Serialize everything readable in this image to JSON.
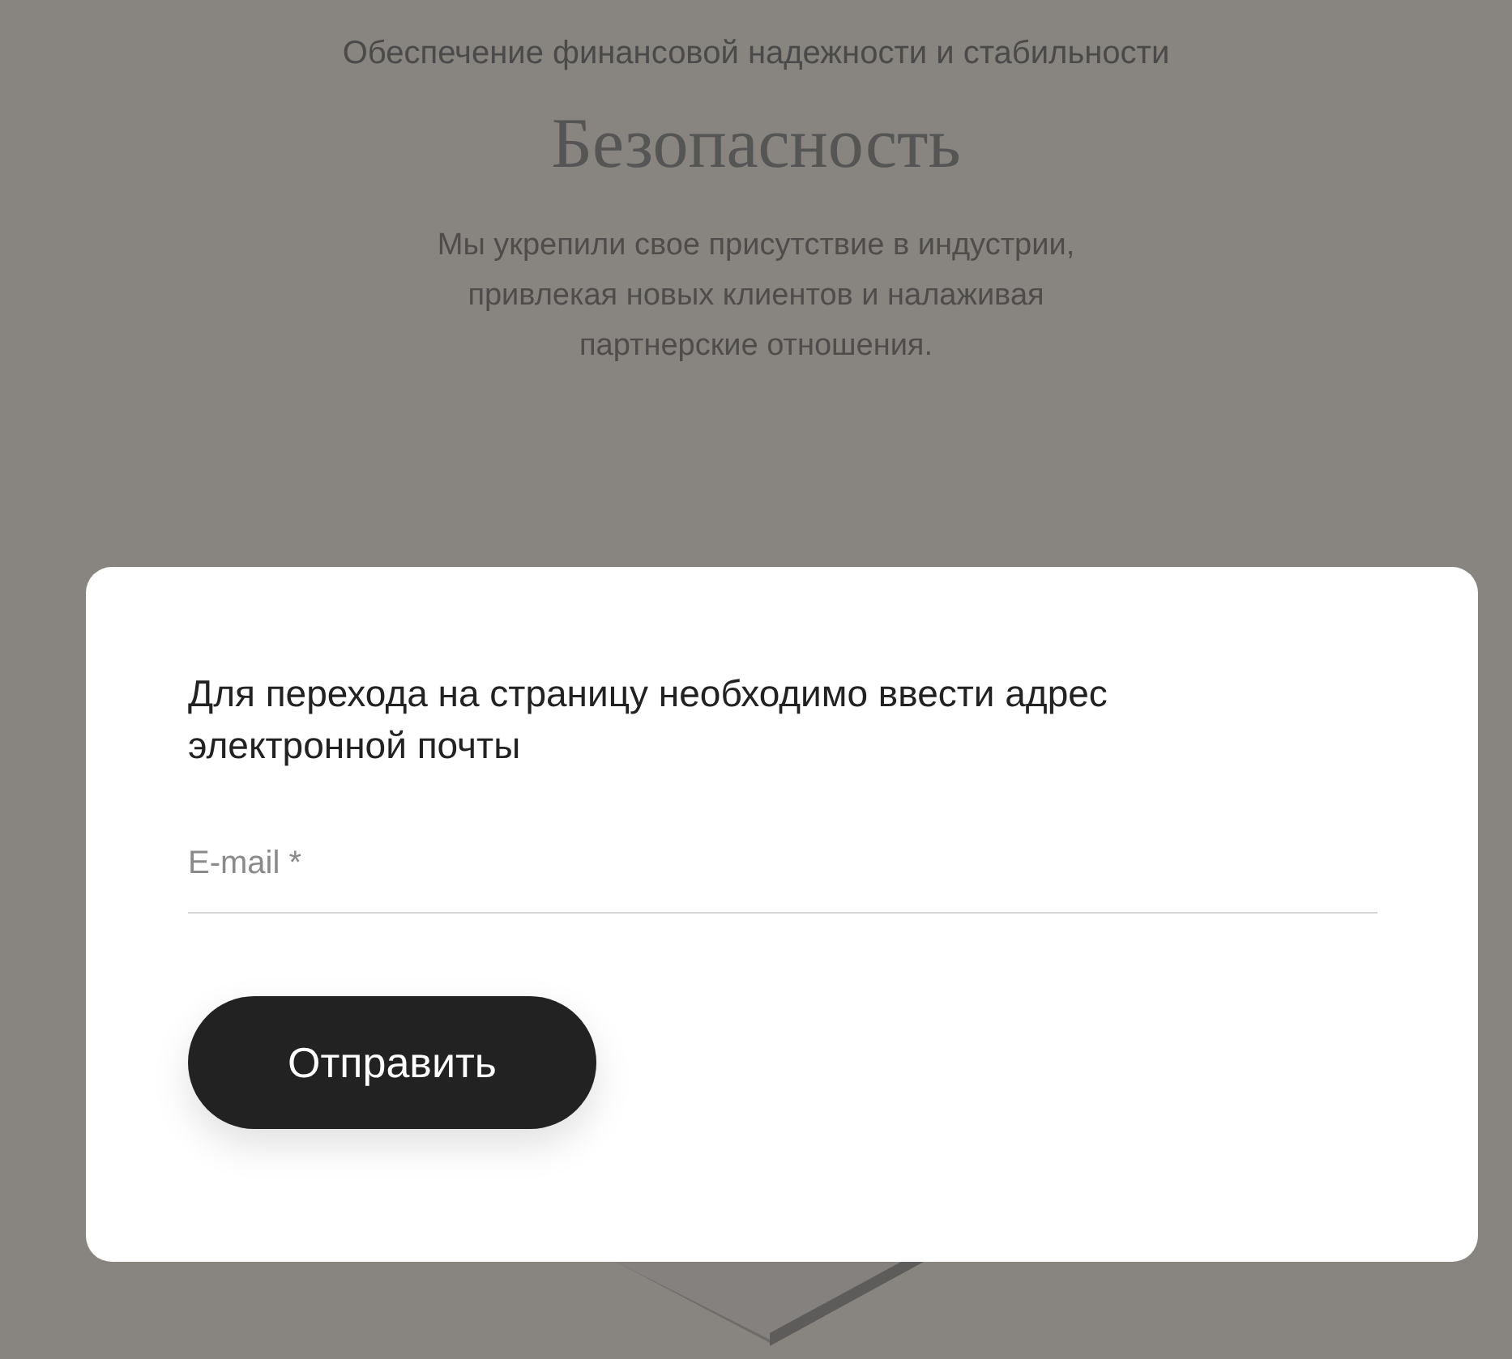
{
  "page": {
    "subtitle": "Обеспечение финансовой надежности и стабильности",
    "title": "Безопасность",
    "description": "Мы укрепили свое присутствие в индустрии, привлекая новых клиентов и налаживая партнерские отношения."
  },
  "dialog": {
    "message": "Для перехода на страницу необходимо ввести адрес электронной почты",
    "email_field": {
      "placeholder": "E-mail *"
    },
    "submit_button": "Отправить"
  }
}
